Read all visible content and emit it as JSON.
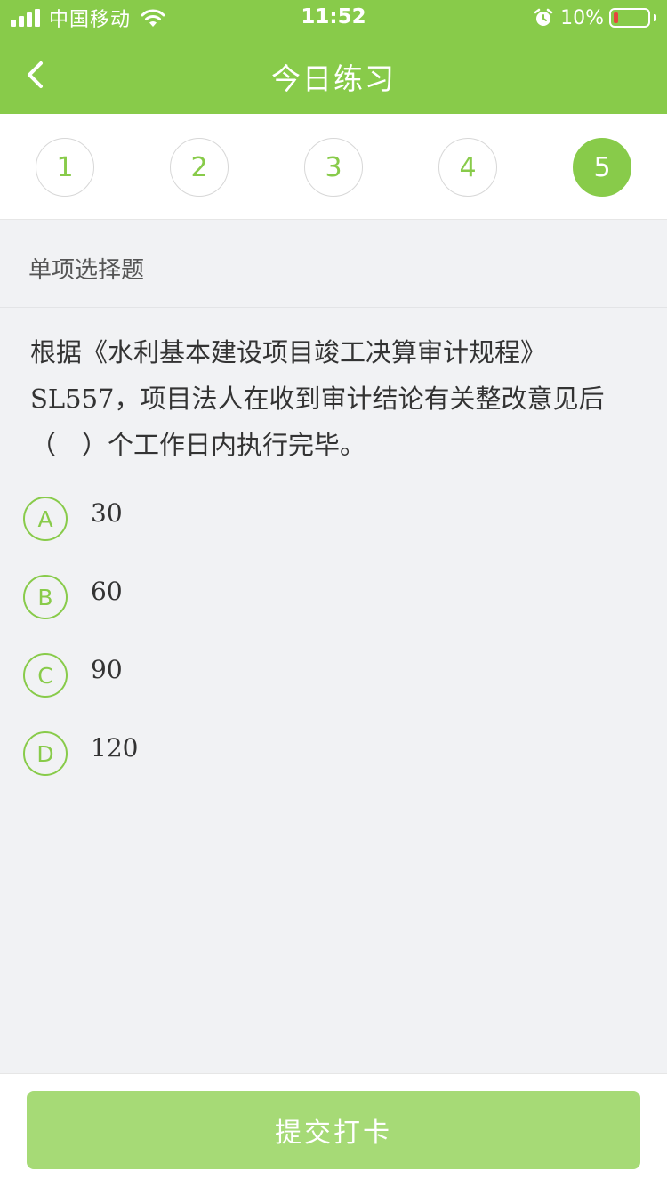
{
  "status_bar": {
    "carrier": "中国移动",
    "time": "11:52",
    "battery": "10%",
    "battery_level": 0.1,
    "icons": [
      "signal-icon",
      "wifi-icon",
      "alarm-icon",
      "battery-icon"
    ]
  },
  "nav": {
    "title": "今日练习",
    "back_icon": "chevron-left-icon"
  },
  "question_numbers": [
    {
      "label": "1",
      "active": false
    },
    {
      "label": "2",
      "active": false
    },
    {
      "label": "3",
      "active": false
    },
    {
      "label": "4",
      "active": false
    },
    {
      "label": "5",
      "active": true
    }
  ],
  "question": {
    "type": "单项选择题",
    "text": "根据《水利基本建设项目竣工决算审计规程》SL557，项目法人在收到审计结论有关整改意见后（　）个工作日内执行完毕。",
    "options": [
      {
        "letter": "A",
        "text": "30"
      },
      {
        "letter": "B",
        "text": "60"
      },
      {
        "letter": "C",
        "text": "90"
      },
      {
        "letter": "D",
        "text": "120"
      }
    ]
  },
  "footer": {
    "submit_label": "提交打卡"
  },
  "colors": {
    "accent": "#88cb4a",
    "button": "#a6da76",
    "background": "#f1f2f4",
    "battery_low": "#e5473d"
  }
}
